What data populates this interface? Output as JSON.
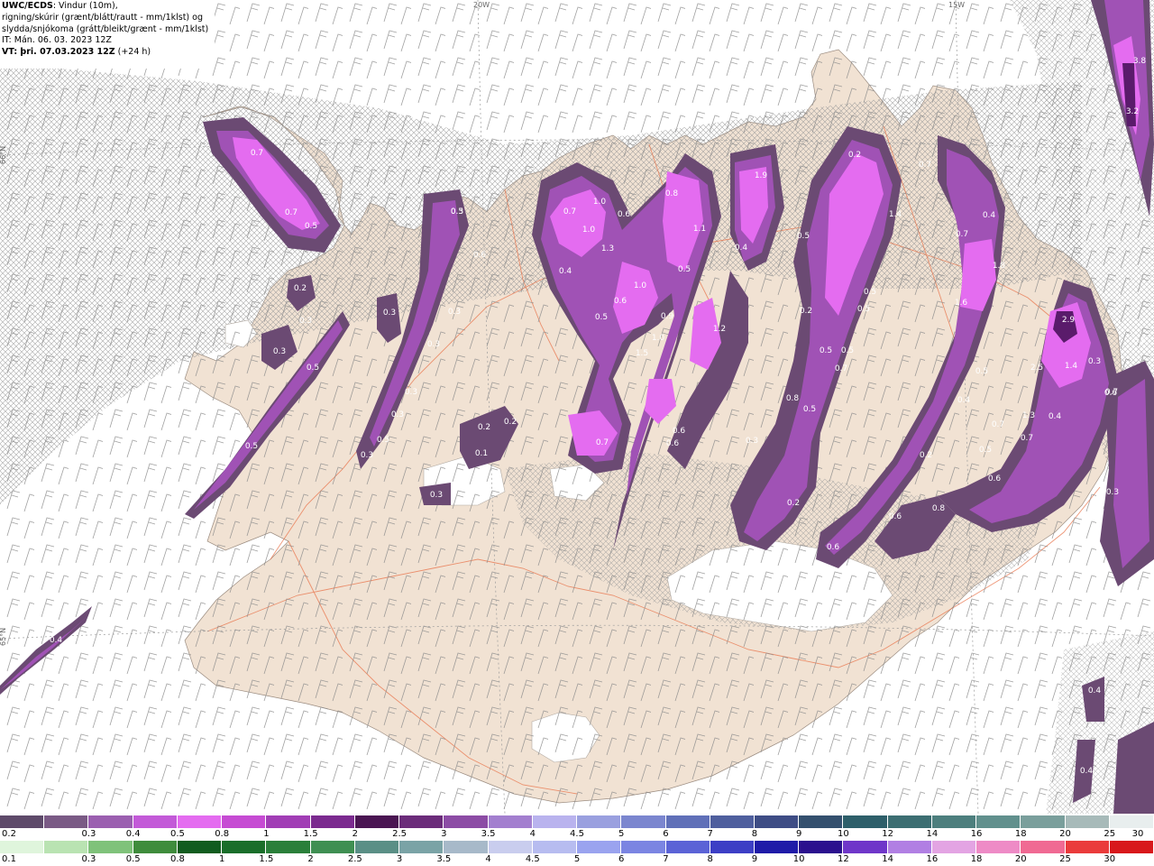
{
  "info_box": {
    "line1_bold": "UWC/ECDS",
    "line1_rest": ": Vindur (10m),",
    "line2": "rigning/skúrir (grænt/blátt/rautt - mm/1klst) og",
    "line3": "slydda/snjókoma (grátt/bleikt/grænt - mm/1klst)",
    "line4": "IT: Mán. 06. 03. 2023 12Z",
    "line5_bold": "VT: þri. 07.03.2023 12Z",
    "line5_rest": " (+24 h)"
  },
  "grid_labels": {
    "lat_66": "66°N",
    "lat_65": "65°N",
    "lon_20": "20W",
    "lon_15": "15W"
  },
  "precip_labels": [
    "0.7",
    "0.7",
    "0.5",
    "0.2",
    "0.3",
    "0.3",
    "0.5",
    "0.5",
    "0.3",
    "0.3",
    "0.3",
    "0.5",
    "0.3",
    "0.3",
    "0.3",
    "0.3",
    "0.6",
    "0.5",
    "0.2",
    "0.2",
    "0.1",
    "0.3",
    "0.7",
    "1.0",
    "0.6",
    "1.0",
    "1.3",
    "0.4",
    "0.5",
    "0.8",
    "1.1",
    "0.5",
    "0.9",
    "1.0",
    "0.6",
    "1.0",
    "1.5",
    "1.2",
    "0.4",
    "1.9",
    "0.7",
    "0.6",
    "0.6",
    "0.3",
    "0.5",
    "0.7",
    "1.4",
    "0.2",
    "0.5",
    "0.4",
    "0.7",
    "1.8",
    "1.6",
    "0.2",
    "0.5",
    "0.5",
    "0.5",
    "0.7",
    "0.8",
    "0.5",
    "0.4",
    "0.5",
    "0.7",
    "0.5",
    "0.2",
    "0.6",
    "0.6",
    "0.8",
    "2.9",
    "2.5",
    "1.4",
    "0.3",
    "1.3",
    "0.4",
    "0.7",
    "0.7",
    "0.6",
    "0.3",
    "3.8",
    "3.2",
    "0.3",
    "0.6",
    "0.6",
    "0.4",
    "0.4",
    "0.4",
    "0.2"
  ],
  "legend_snow": {
    "ticks": [
      "0.2",
      "0.3",
      "0.4",
      "0.5",
      "0.8",
      "1",
      "1.5",
      "2",
      "2.5",
      "3",
      "3.5",
      "4",
      "4.5",
      "5",
      "6",
      "7",
      "8",
      "9",
      "10",
      "12",
      "14",
      "16",
      "18",
      "20",
      "25",
      "30"
    ],
    "colors": [
      "#5e4a6a",
      "#7a5a85",
      "#9b5fb0",
      "#c35ad8",
      "#e46cf0",
      "#c64bd3",
      "#a13db5",
      "#7b2a8f",
      "#4a1552",
      "#6b2c7a",
      "#8c4ca5",
      "#a37fcf",
      "#b9b3ee",
      "#9aa0df",
      "#7b86cf",
      "#6070b8",
      "#4f5f9e",
      "#3e4d85",
      "#34506e",
      "#2e5f6a",
      "#3c6e72",
      "#4d7f7e",
      "#61908d",
      "#7a9f9c",
      "#a7bab9",
      "#e8eeee"
    ]
  },
  "legend_rain": {
    "ticks": [
      "0.1",
      "0.3",
      "0.5",
      "0.8",
      "1",
      "1.5",
      "2",
      "2.5",
      "3",
      "3.5",
      "4",
      "4.5",
      "5",
      "6",
      "7",
      "8",
      "9",
      "10",
      "12",
      "14",
      "16",
      "18",
      "20",
      "25",
      "30"
    ],
    "colors": [
      "#dff5dc",
      "#b9e3b2",
      "#7fc27a",
      "#3f8c3c",
      "#115c1f",
      "#1a6e2a",
      "#2a7f3a",
      "#3f8f52",
      "#5a8f86",
      "#7aa3a6",
      "#a7b9c9",
      "#c9cdee",
      "#b7bcf0",
      "#9aa3ef",
      "#7b85e2",
      "#5b63d6",
      "#3d3fc5",
      "#1f1ba8",
      "#2b108e",
      "#6f36c9",
      "#b17fe3",
      "#e3a4e3",
      "#ee8bc6",
      "#f06a93",
      "#ea3b3b",
      "#d8181b"
    ]
  }
}
